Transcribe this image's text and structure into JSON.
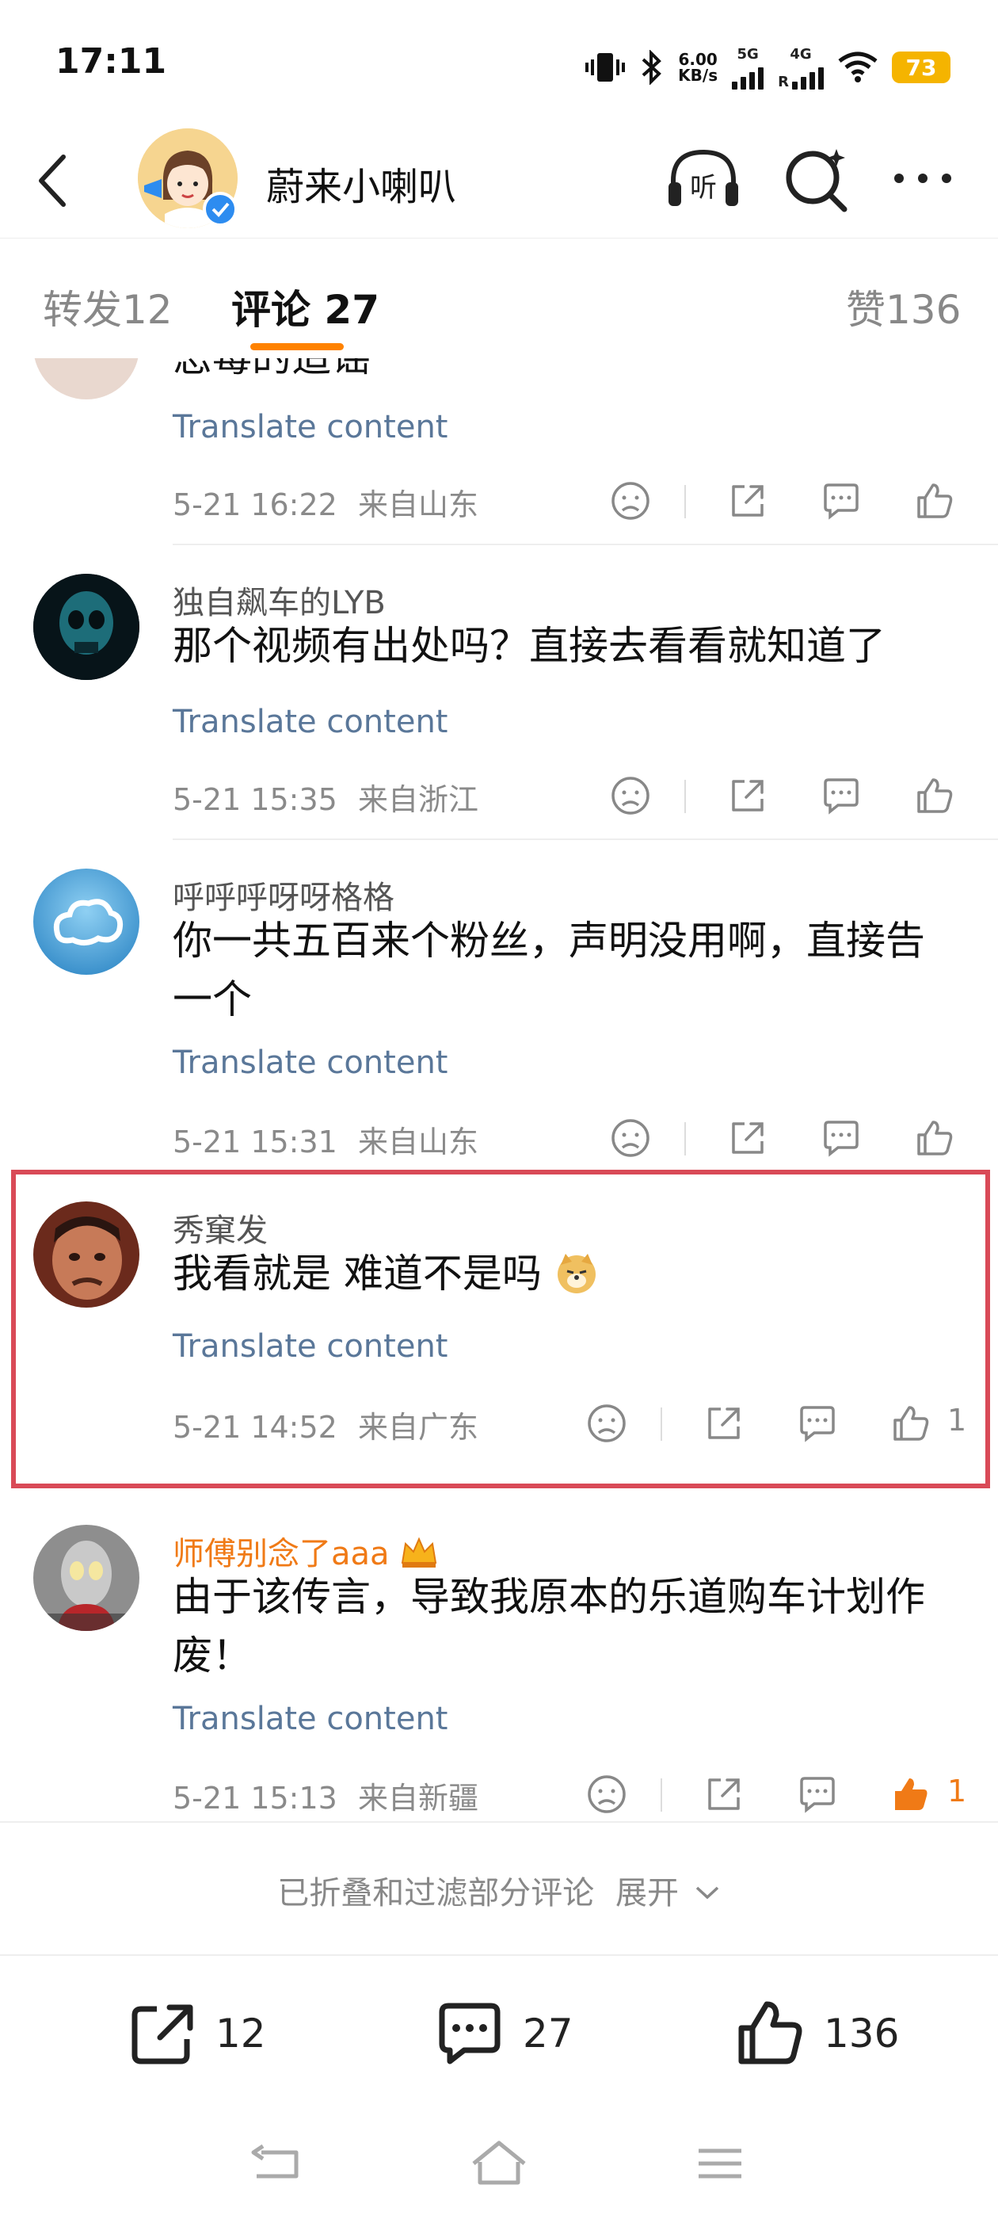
{
  "status_bar": {
    "time": "17:11",
    "net_speed_value": "6.00",
    "net_speed_unit": "KB/s",
    "sim1_label": "5G",
    "sim2_label": "4G",
    "sim2_sub": "R",
    "battery": "73",
    "battery_color": "#f5b400"
  },
  "header": {
    "title": "蔚来小喇叭",
    "icons": [
      "back-icon",
      "listen-icon",
      "search-icon",
      "more-icon"
    ]
  },
  "tabs": [
    {
      "label": "转发",
      "count": "12"
    },
    {
      "label": "评论",
      "count": "27"
    },
    {
      "label": "赞",
      "count": "136"
    }
  ],
  "comments": [
    {
      "username": "",
      "text": "恶毒的造谣",
      "translate": "Translate content",
      "date": "5-21 16:22",
      "location": "来自山东",
      "likes": ""
    },
    {
      "username": "独自飙车的LYB",
      "text": "那个视频有出处吗？直接去看看就知道了",
      "translate": "Translate content",
      "date": "5-21 15:35",
      "location": "来自浙江",
      "likes": ""
    },
    {
      "username": "呼呼呼呀呀格格",
      "text": "你一共五百来个粉丝，声明没用啊，直接告一个",
      "translate": "Translate content",
      "date": "5-21 15:31",
      "location": "来自山东",
      "likes": ""
    },
    {
      "username": "秀窠发",
      "text": "我看就是 难道不是吗",
      "translate": "Translate content",
      "date": "5-21 14:52",
      "location": "来自广东",
      "likes": "1"
    },
    {
      "username": "师傅别念了aaa",
      "text": "由于该传言，导致我原本的乐道购车计划作废！",
      "translate": "Translate content",
      "date": "5-21 15:13",
      "location": "来自新疆",
      "likes": "1"
    }
  ],
  "folded": {
    "text": "已折叠和过滤部分评论",
    "expand": "展开"
  },
  "bottom_bar": {
    "repost_count": "12",
    "comment_count": "27",
    "like_count": "136"
  },
  "colors": {
    "accent": "#ff8200",
    "highlight_border": "#d94a57",
    "translate_link": "#5a7799",
    "liked": "#f07a16"
  }
}
